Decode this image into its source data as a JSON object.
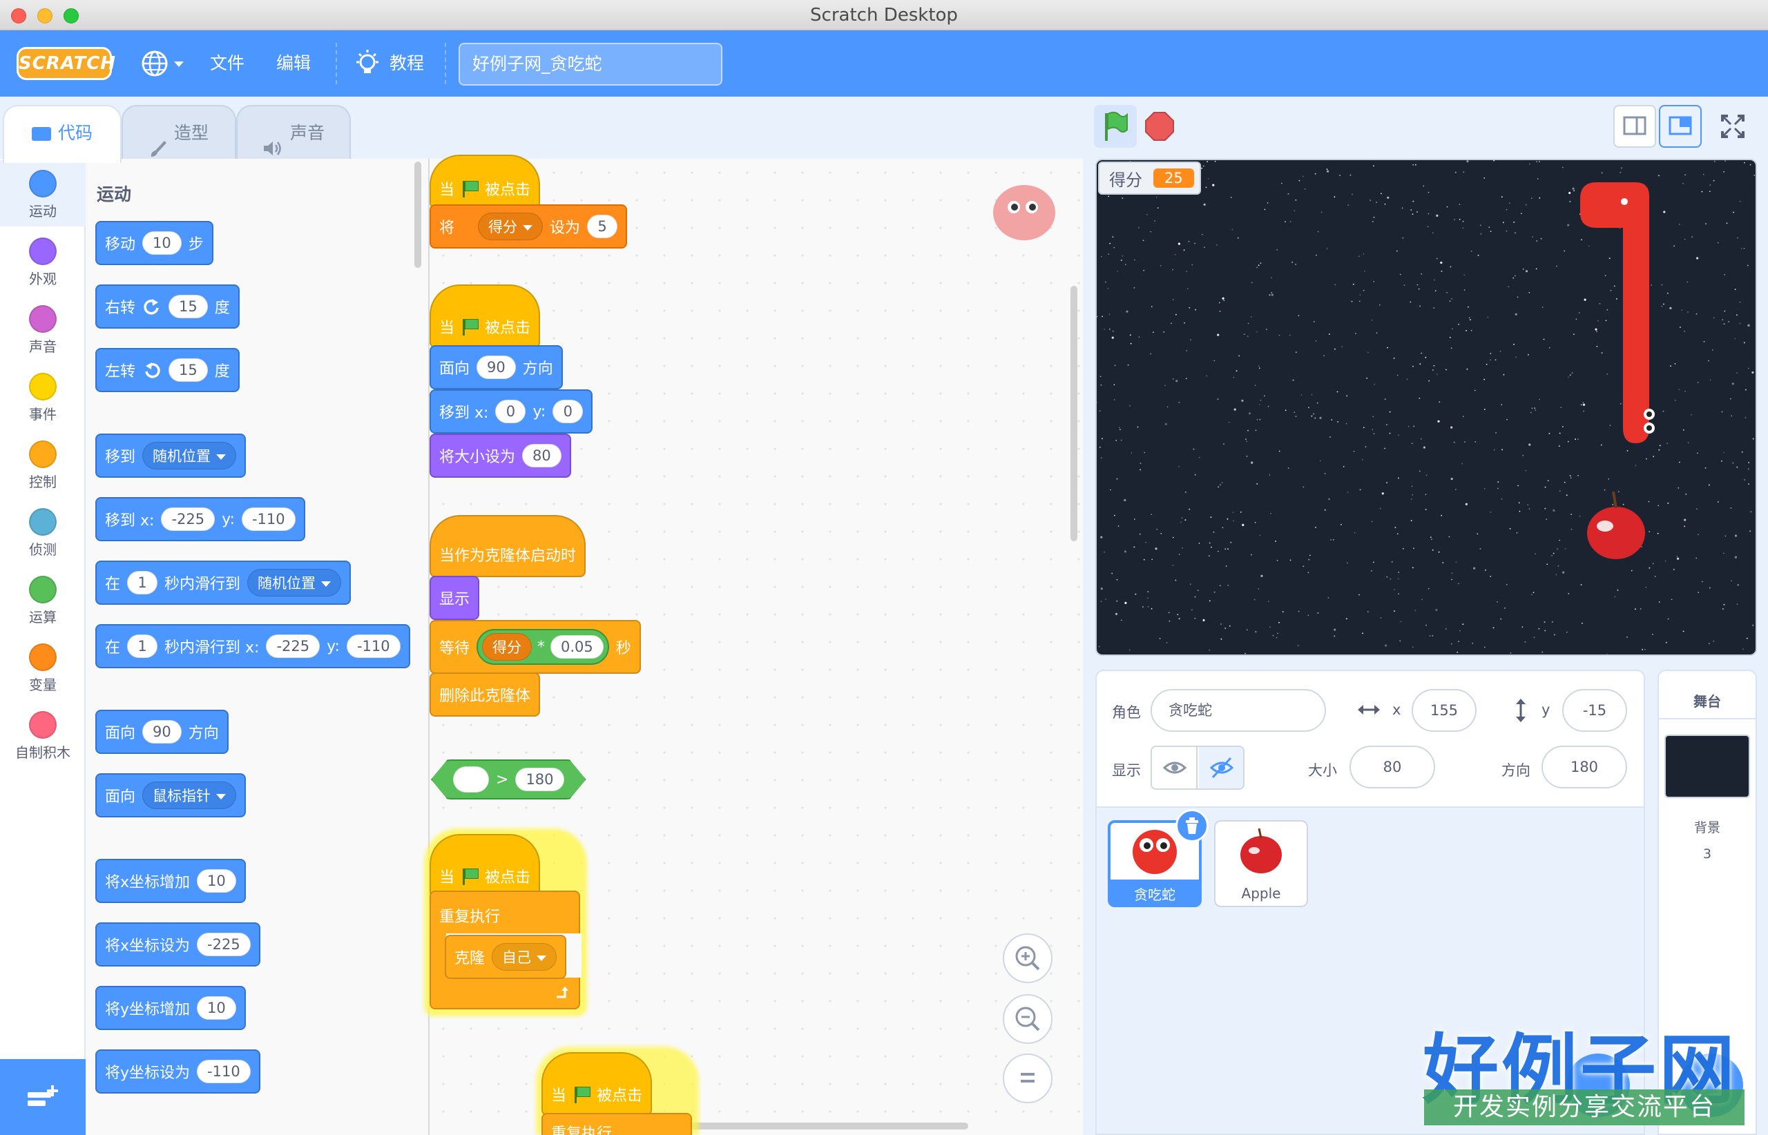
{
  "window": {
    "title": "Scratch Desktop"
  },
  "menu": {
    "logo": "SCRATCH",
    "file": "文件",
    "edit": "编辑",
    "tutorials": "教程",
    "project_title": "好例子网_贪吃蛇"
  },
  "tabs": {
    "code": "代码",
    "costumes": "造型",
    "sounds": "声音"
  },
  "categories": [
    {
      "label": "运动",
      "color": "#4c97ff"
    },
    {
      "label": "外观",
      "color": "#9966ff"
    },
    {
      "label": "声音",
      "color": "#cf63cf"
    },
    {
      "label": "事件",
      "color": "#ffd500"
    },
    {
      "label": "控制",
      "color": "#ffab19"
    },
    {
      "label": "侦测",
      "color": "#5cb1d6"
    },
    {
      "label": "运算",
      "color": "#59c059"
    },
    {
      "label": "变量",
      "color": "#ff8c1a"
    },
    {
      "label": "自制积木",
      "color": "#ff6680"
    }
  ],
  "palette": {
    "section": "运动",
    "move": {
      "a": "移动",
      "v": "10",
      "b": "步"
    },
    "turn_right": {
      "a": "右转",
      "v": "15",
      "b": "度"
    },
    "turn_left": {
      "a": "左转",
      "v": "15",
      "b": "度"
    },
    "goto": {
      "a": "移到",
      "dd": "随机位置"
    },
    "goto_xy": {
      "a": "移到 x:",
      "x": "-225",
      "b": "y:",
      "y": "-110"
    },
    "glide": {
      "a": "在",
      "v": "1",
      "b": "秒内滑行到",
      "dd": "随机位置"
    },
    "glide_xy": {
      "a": "在",
      "v": "1",
      "b": "秒内滑行到 x:",
      "x": "-225",
      "c": "y:",
      "y": "-110"
    },
    "point": {
      "a": "面向",
      "v": "90",
      "b": "方向"
    },
    "point_towards": {
      "a": "面向",
      "dd": "鼠标指针"
    },
    "change_x": {
      "a": "将x坐标增加",
      "v": "10"
    },
    "set_x": {
      "a": "将x坐标设为",
      "v": "-225"
    },
    "change_y": {
      "a": "将y坐标增加",
      "v": "10"
    },
    "set_y": {
      "a": "将y坐标设为",
      "v": "-110"
    }
  },
  "scripts": {
    "s1": {
      "when": "当",
      "clicked": "被点击",
      "set_a": "将",
      "set_var": "得分",
      "set_b": "设为",
      "set_v": "5"
    },
    "s2": {
      "when": "当",
      "clicked": "被点击",
      "point_a": "面向",
      "point_v": "90",
      "point_b": "方向",
      "goto_a": "移到 x:",
      "goto_x": "0",
      "goto_b": "y:",
      "goto_y": "0",
      "size_a": "将大小设为",
      "size_v": "80"
    },
    "s3": {
      "hat": "当作为克隆体启动时",
      "show": "显示",
      "wait_a": "等待",
      "wait_var": "得分",
      "op": "*",
      "wait_v": "0.05",
      "wait_b": "秒",
      "delete": "删除此克隆体"
    },
    "s4": {
      "op": ">",
      "v": "180"
    },
    "s5": {
      "when": "当",
      "clicked": "被点击",
      "forever": "重复执行",
      "clone_a": "克隆",
      "clone_dd": "自己"
    },
    "s6": {
      "when": "当",
      "clicked": "被点击",
      "next": "重复执行"
    }
  },
  "stage": {
    "monitor_label": "得分",
    "monitor_value": "25"
  },
  "sprite_info": {
    "sprite_label": "角色",
    "sprite_name": "贪吃蛇",
    "x_label": "x",
    "x": "155",
    "y_label": "y",
    "y": "-15",
    "show_label": "显示",
    "size_label": "大小",
    "size": "80",
    "dir_label": "方向",
    "direction": "180"
  },
  "sprites": [
    {
      "name": "贪吃蛇"
    },
    {
      "name": "Apple"
    }
  ],
  "stage_panel": {
    "title": "舞台",
    "backdrops_label": "背景",
    "backdrops": "3"
  },
  "watermark": {
    "main": "好例子网",
    "sub": "开发实例分享交流平台"
  }
}
